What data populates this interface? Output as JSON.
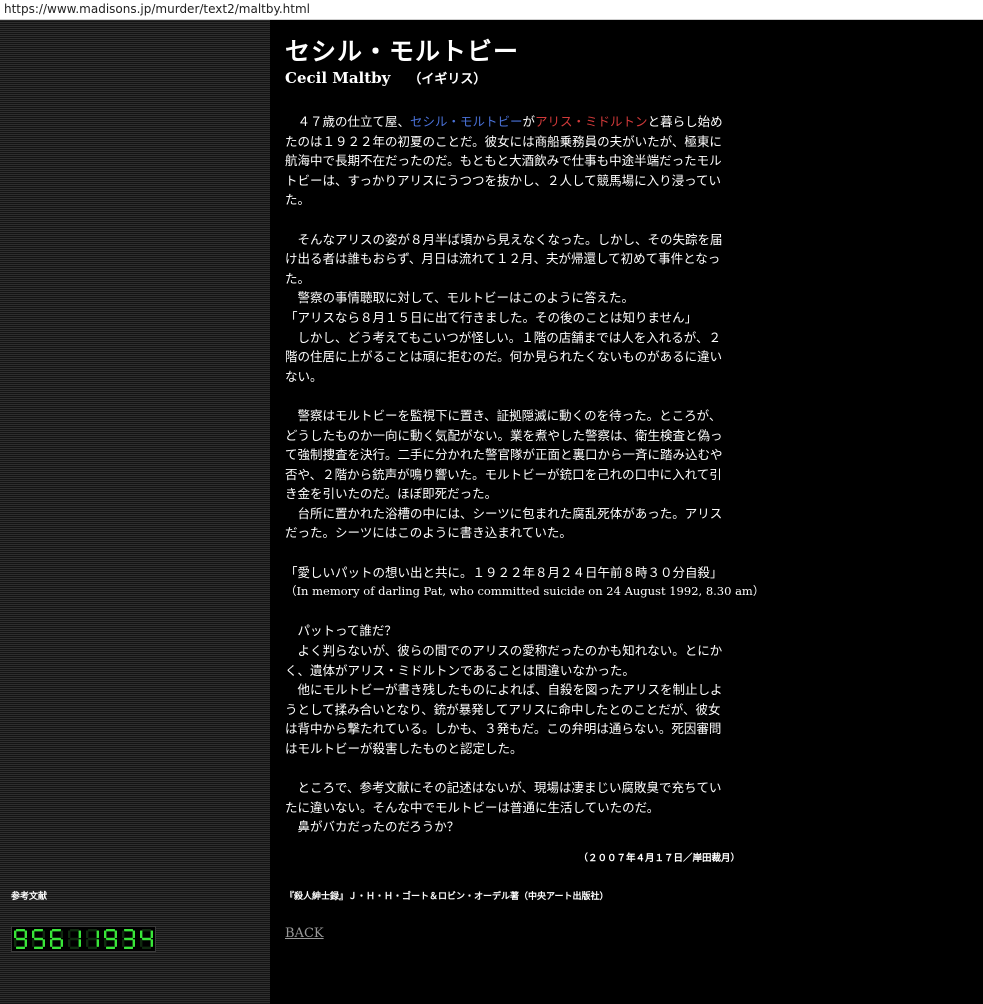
{
  "browser": {
    "url": "https://www.madisons.jp/murder/text2/maltby.html"
  },
  "header": {
    "title": "セシル・モルトビー",
    "subtitle_en": "Cecil Maltby",
    "subtitle_country": "（イギリス）"
  },
  "article": {
    "p1": {
      "pre": "　４７歳の仕立て屋、",
      "name1": "セシル・モルトビー",
      "mid": "が",
      "name2": "アリス・ミドルトン",
      "post": "と暮らし始め",
      "lines": [
        "たのは１９２２年の初夏のことだ。彼女には商船乗務員の夫がいたが、極東に",
        "航海中で長期不在だったのだ。もともと大酒飲みで仕事も中途半端だったモル",
        "トビーは、すっかりアリスにうつつを抜かし、２人して競馬場に入り浸ってい",
        "た。"
      ]
    },
    "p2": [
      "　そんなアリスの姿が８月半ば頃から見えなくなった。しかし、その失踪を届",
      "け出る者は誰もおらず、月日は流れて１２月、夫が帰還して初めて事件となっ",
      "た。",
      "　警察の事情聴取に対して、モルトビーはこのように答えた。",
      "「アリスなら８月１５日に出て行きました。その後のことは知りません」",
      "　しかし、どう考えてもこいつが怪しい。１階の店舗までは人を入れるが、２",
      "階の住居に上がることは頑に拒むのだ。何か見られたくないものがあるに違い",
      "ない。"
    ],
    "p3": [
      "　警察はモルトビーを監視下に置き、証拠隠滅に動くのを待った。ところが、",
      "どうしたものか一向に動く気配がない。業を煮やした警察は、衛生検査と偽っ",
      "て強制捜査を決行。二手に分かれた警官隊が正面と裏口から一斉に踏み込むや",
      "否や、２階から銃声が鳴り響いた。モルトビーが銃口を己れの口中に入れて引",
      "き金を引いたのだ。ほぼ即死だった。",
      "　台所に置かれた浴槽の中には、シーツに包まれた腐乱死体があった。アリス",
      "だった。シーツにはこのように書き込まれていた。"
    ],
    "quote_jp": "「愛しいパットの想い出と共に。１９２２年８月２４日午前８時３０分自殺」",
    "quote_en": "（In memory of darling Pat, who committed suicide on 24 August 1992, 8.30 am）",
    "p5": [
      "　パットって誰だ？",
      "　よく判らないが、彼らの間でのアリスの愛称だったのかも知れない。とにか",
      "く、遺体がアリス・ミドルトンであることは間違いなかった。",
      "　他にモルトビーが書き残したものによれば、自殺を図ったアリスを制止しよ",
      "うとして揉み合いとなり、銃が暴発してアリスに命中したとのことだが、彼女",
      "は背中から撃たれている。しかも、３発もだ。この弁明は通らない。死因審問",
      "はモルトビーが殺害したものと認定した。"
    ],
    "p6": [
      "　ところで、参考文献にその記述はないが、現場は凄まじい腐敗臭で充ちてい",
      "たに違いない。そんな中でモルトビーは普通に生活していたのだ。",
      "　鼻がバカだったのだろうか？"
    ],
    "signature": "（２００７年４月１７日／岸田裁月）"
  },
  "sidebar": {
    "ref_label": "参考文献",
    "counter_digits": [
      "9",
      "5",
      "6",
      "1",
      "1",
      "9",
      "3",
      "4"
    ],
    "counter_color": "#39e639"
  },
  "references": {
    "text": "『殺人紳士録』Ｊ・Ｈ・Ｈ・ゴート＆ロビン・オーデル著（中央アート出版社）"
  },
  "nav": {
    "back_label": "BACK"
  }
}
